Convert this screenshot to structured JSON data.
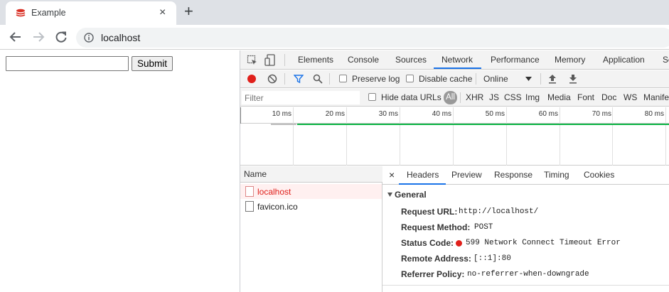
{
  "browser": {
    "tab_title": "Example",
    "tab_close": "×",
    "new_tab": "+",
    "url": "localhost"
  },
  "page": {
    "input_value": "",
    "submit_label": "Submit"
  },
  "devtools": {
    "panels": [
      "Elements",
      "Console",
      "Sources",
      "Network",
      "Performance",
      "Memory",
      "Application",
      "Se"
    ],
    "active_panel": "Network",
    "network_toolbar": {
      "preserve_log": "Preserve log",
      "disable_cache": "Disable cache",
      "throttling": "Online"
    },
    "filter": {
      "placeholder": "Filter",
      "hide_data_urls": "Hide data URLs",
      "types": [
        "All",
        "XHR",
        "JS",
        "CSS",
        "Img",
        "Media",
        "Font",
        "Doc",
        "WS",
        "Manife"
      ]
    },
    "timeline_ticks": [
      "10 ms",
      "20 ms",
      "30 ms",
      "40 ms",
      "50 ms",
      "60 ms",
      "70 ms",
      "80 ms"
    ],
    "list_header": "Name",
    "requests": [
      {
        "name": "localhost",
        "status": "error"
      },
      {
        "name": "favicon.ico",
        "status": "ok"
      }
    ],
    "detail_close": "×",
    "detail_tabs": [
      "Headers",
      "Preview",
      "Response",
      "Timing",
      "Cookies"
    ],
    "active_detail_tab": "Headers",
    "general": {
      "heading": "General",
      "rows": [
        {
          "key": "Request URL:",
          "value": "http://localhost/"
        },
        {
          "key": "Request Method:",
          "value": "POST"
        },
        {
          "key": "Status Code:",
          "value": "599 Network Connect Timeout Error"
        },
        {
          "key": "Remote Address:",
          "value": "[::1]:80"
        },
        {
          "key": "Referrer Policy:",
          "value": "no-referrer-when-downgrade"
        }
      ]
    }
  },
  "colors": {
    "accent": "#1a73e8",
    "error": "#e0201b",
    "error_row_bg": "#fff0f0",
    "timeline_bar": "#0cb444"
  }
}
